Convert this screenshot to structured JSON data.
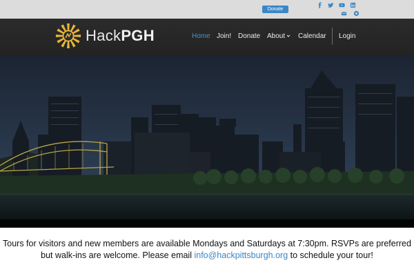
{
  "topbar": {
    "donate_label": "Donate",
    "social_row1": [
      "facebook-icon",
      "twitter-icon",
      "youtube-icon",
      "linkedin-icon"
    ],
    "social_row2": [
      "email-icon",
      "meetup-icon"
    ]
  },
  "header": {
    "logo_text_light": "Hack",
    "logo_text_bold": "PGH"
  },
  "nav": {
    "items": [
      {
        "label": "Home",
        "active": true
      },
      {
        "label": "Join!",
        "active": false
      },
      {
        "label": "Donate",
        "active": false
      },
      {
        "label": "About",
        "active": false,
        "dropdown": true
      },
      {
        "label": "Calendar",
        "active": false
      },
      {
        "label": "Login",
        "active": false
      }
    ]
  },
  "hero": {
    "image": "pittsburgh-skyline-night"
  },
  "info": {
    "line_part1": "Tours for visitors and new members are available Mondays and Saturdays at 7:30pm. RSVPs are preferred but walk-ins are welcome. Please email",
    "email": "info@hackpittsburgh.org",
    "line_part2": "to schedule your tour!"
  },
  "colors": {
    "accent": "#3f96d6",
    "header_bg": "#262626",
    "topbar_bg": "#dcdcdc",
    "donate_bg": "#3a87c8",
    "logo_gold": "#e8b53a"
  }
}
